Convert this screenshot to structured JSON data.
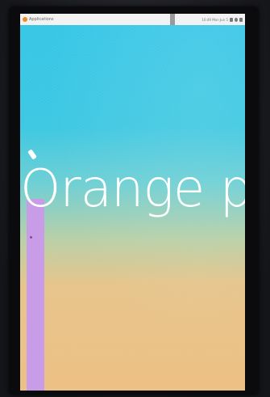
{
  "panel": {
    "app_menu_label": "Applications",
    "tray_text": "16:49 Mon Jun 5"
  },
  "wallpaper": {
    "brand_text": "Orange p",
    "colors": {
      "sky": "#35c6e6",
      "sand": "#edbf83",
      "bar": "#c89ce6"
    }
  },
  "icons": [
    "menu-logo-icon",
    "network-icon",
    "volume-icon",
    "power-icon"
  ]
}
